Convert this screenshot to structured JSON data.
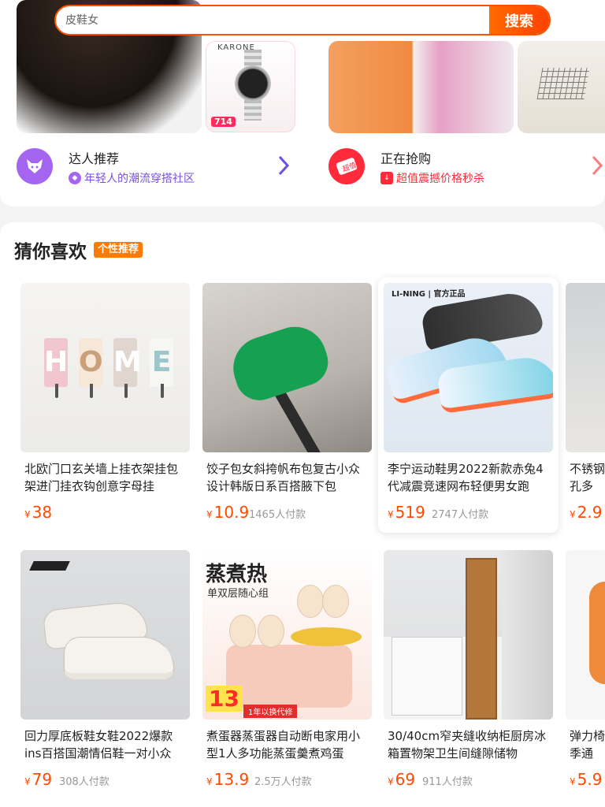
{
  "search": {
    "placeholder": "皮鞋女",
    "button_label": "搜索"
  },
  "promo_images": {
    "watch_brand": "KARONE",
    "watch_price": "714"
  },
  "entries": [
    {
      "title": "达人推荐",
      "subtitle": "年轻人的潮流穿搭社区",
      "icon": "fox-icon",
      "color": "#a466f0"
    },
    {
      "title": "正在抢购",
      "subtitle": "超值震撼价格秒杀",
      "icon": "sale-tag-icon",
      "color": "#ff2b3a"
    }
  ],
  "guess": {
    "title": "猜你喜欢",
    "tag": "个性推荐"
  },
  "products": [
    {
      "title": "北欧门口玄关墙上挂衣架挂包架进门挂衣钩创意字母挂",
      "price": "38",
      "sold": ""
    },
    {
      "title": "饺子包女斜挎帆布包复古小众设计韩版日系百搭腋下包",
      "price": "10.9",
      "sold": "1465人付款"
    },
    {
      "title": "李宁运动鞋男2022新款赤兔4代减震竞速网布轻便男女跑",
      "price": "519",
      "sold": "2747人付款",
      "brand_tag": "LI-NING | 官方正品"
    },
    {
      "title": "不锈钢打孔多",
      "price": "2.9",
      "sold": ""
    },
    {
      "title": "回力厚底板鞋女鞋2022爆款ins百搭国潮情侣鞋一对小众",
      "price": "79",
      "sold": "308人付款"
    },
    {
      "title": "煮蛋器蒸蛋器自动断电家用小型1人多功能蒸蛋羹煮鸡蛋",
      "price": "13.9",
      "sold": "2.5万人付款",
      "ad_title": "蒸煮热",
      "ad_sub": "单双层随心组",
      "ad_price": "13",
      "ad_ribbon": "1年以换代修"
    },
    {
      "title": "30/40cm窄夹缝收纳柜厨房冰箱置物架卫生间缝隙储物",
      "price": "69",
      "sold": "911人付款"
    },
    {
      "title": "弹力椅四季通",
      "price": "5.9",
      "sold": ""
    }
  ],
  "colors": {
    "accent": "#ff5000",
    "price": "#ff4a00"
  }
}
